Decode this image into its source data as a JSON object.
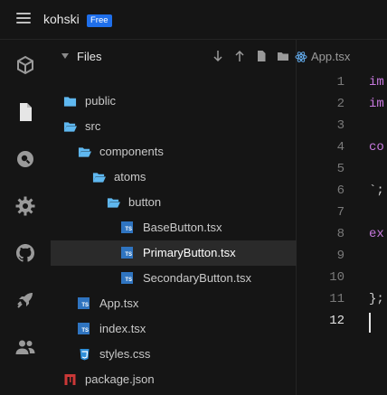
{
  "brand": {
    "name": "kohski",
    "badge": "Free"
  },
  "explorer": {
    "title": "Files",
    "tree": [
      {
        "label": "public",
        "kind": "folder"
      },
      {
        "label": "src",
        "kind": "folder-open"
      },
      {
        "label": "components",
        "kind": "folder-open"
      },
      {
        "label": "atoms",
        "kind": "folder-open"
      },
      {
        "label": "button",
        "kind": "folder-open"
      },
      {
        "label": "BaseButton.tsx",
        "kind": "ts"
      },
      {
        "label": "PrimaryButton.tsx",
        "kind": "ts",
        "selected": true
      },
      {
        "label": "SecondaryButton.tsx",
        "kind": "ts"
      },
      {
        "label": "App.tsx",
        "kind": "ts"
      },
      {
        "label": "index.tsx",
        "kind": "ts"
      },
      {
        "label": "styles.css",
        "kind": "css"
      },
      {
        "label": "package.json",
        "kind": "json"
      }
    ]
  },
  "tab": {
    "label": "App.tsx"
  },
  "editor": {
    "line_numbers": [
      "1",
      "2",
      "3",
      "4",
      "5",
      "6",
      "7",
      "8",
      "9",
      "10",
      "11",
      "12"
    ],
    "active_line": "12",
    "lines": [
      {
        "text": "im",
        "color": "#c678dd"
      },
      {
        "text": "im",
        "color": "#c678dd"
      },
      {
        "text": "",
        "color": "#cfcfcf"
      },
      {
        "text": "co",
        "color": "#c678dd"
      },
      {
        "text": "",
        "color": "#cfcfcf"
      },
      {
        "text": "`;",
        "color": "#cfcfcf"
      },
      {
        "text": "",
        "color": "#cfcfcf"
      },
      {
        "text": "ex",
        "color": "#c678dd"
      },
      {
        "text": "",
        "color": "#cfcfcf"
      },
      {
        "text": "",
        "color": "#cfcfcf"
      },
      {
        "text": "};",
        "color": "#cfcfcf"
      },
      {
        "text": "",
        "color": "#cfcfcf"
      }
    ]
  }
}
